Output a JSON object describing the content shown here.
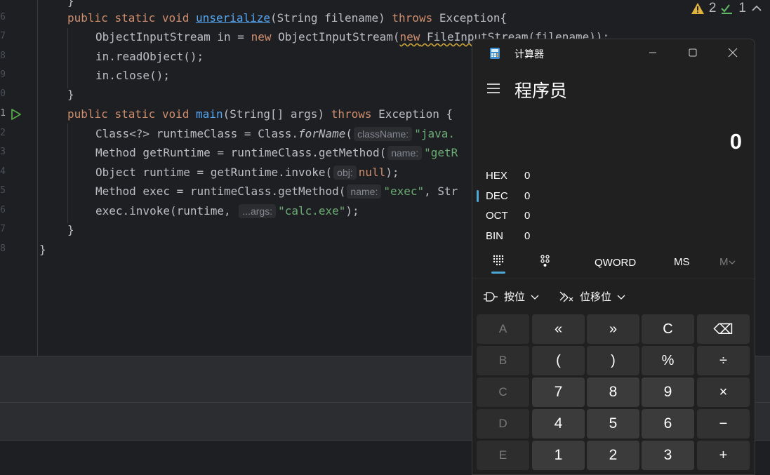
{
  "ide": {
    "line_numbers": [
      "6",
      "7",
      "8",
      "9",
      "0",
      "1",
      "2",
      "3",
      "4",
      "5",
      "6",
      "7",
      "8"
    ],
    "code": {
      "l1_close": "}",
      "l2_public": "public",
      "l2_static": "static",
      "l2_void": "void",
      "l2_method": "unserialize",
      "l2_params": "(String filename) ",
      "l2_throws": "throws",
      "l2_exc": " Exception{",
      "l3_a": "ObjectInputStream in = ",
      "l3_new": "new",
      "l3_b": " ObjectInputStream(",
      "l3_new2": "new",
      "l3_c": " FileInputStream(filename));",
      "l4": "in.readObject();",
      "l5": "in.close();",
      "l6": "}",
      "l7_public": "public",
      "l7_static": "static",
      "l7_void": "void",
      "l7_method": "main",
      "l7_params": "(String[] args) ",
      "l7_throws": "throws",
      "l7_exc": " Exception {",
      "l8_a": "Class<?> runtimeClass = Class.",
      "l8_forname": "forName",
      "l8_paren": "(",
      "l8_hint": "className:",
      "l8_str": "\"java.",
      "l9_a": "Method getRuntime = runtimeClass.getMethod(",
      "l9_hint": "name:",
      "l9_str": "\"getR",
      "l10_a": "Object runtime = getRuntime.invoke(",
      "l10_hint": "obj:",
      "l10_null": "null",
      "l10_end": ");",
      "l11_a": "Method exec = runtimeClass.getMethod(",
      "l11_hint": "name:",
      "l11_str": "\"exec\"",
      "l11_end": ", Str",
      "l12_a": "exec.invoke(runtime, ",
      "l12_hint": "...args:",
      "l12_str": "\"calc.exe\"",
      "l12_end": ");",
      "l13": "}",
      "l14": "}"
    },
    "inspection": {
      "warnings": "2",
      "ok": "1"
    }
  },
  "calculator": {
    "window_title": "计算器",
    "mode": "程序员",
    "display_value": "0",
    "radix": [
      {
        "name": "HEX",
        "value": "0"
      },
      {
        "name": "DEC",
        "value": "0"
      },
      {
        "name": "OCT",
        "value": "0"
      },
      {
        "name": "BIN",
        "value": "0"
      }
    ],
    "word_size": "QWORD",
    "memory_store": "MS",
    "memory_menu": "M",
    "bitwise_label": "按位",
    "bitshift_label": "位移位",
    "keys": [
      [
        "A",
        "«",
        "»",
        "C",
        "⌫"
      ],
      [
        "B",
        "(",
        ")",
        "%",
        "÷"
      ],
      [
        "C",
        "7",
        "8",
        "9",
        "×"
      ],
      [
        "D",
        "4",
        "5",
        "6",
        "−"
      ],
      [
        "E",
        "1",
        "2",
        "3",
        "+"
      ]
    ],
    "colors": {
      "accent": "#4ea9d6",
      "background": "#202020"
    }
  }
}
